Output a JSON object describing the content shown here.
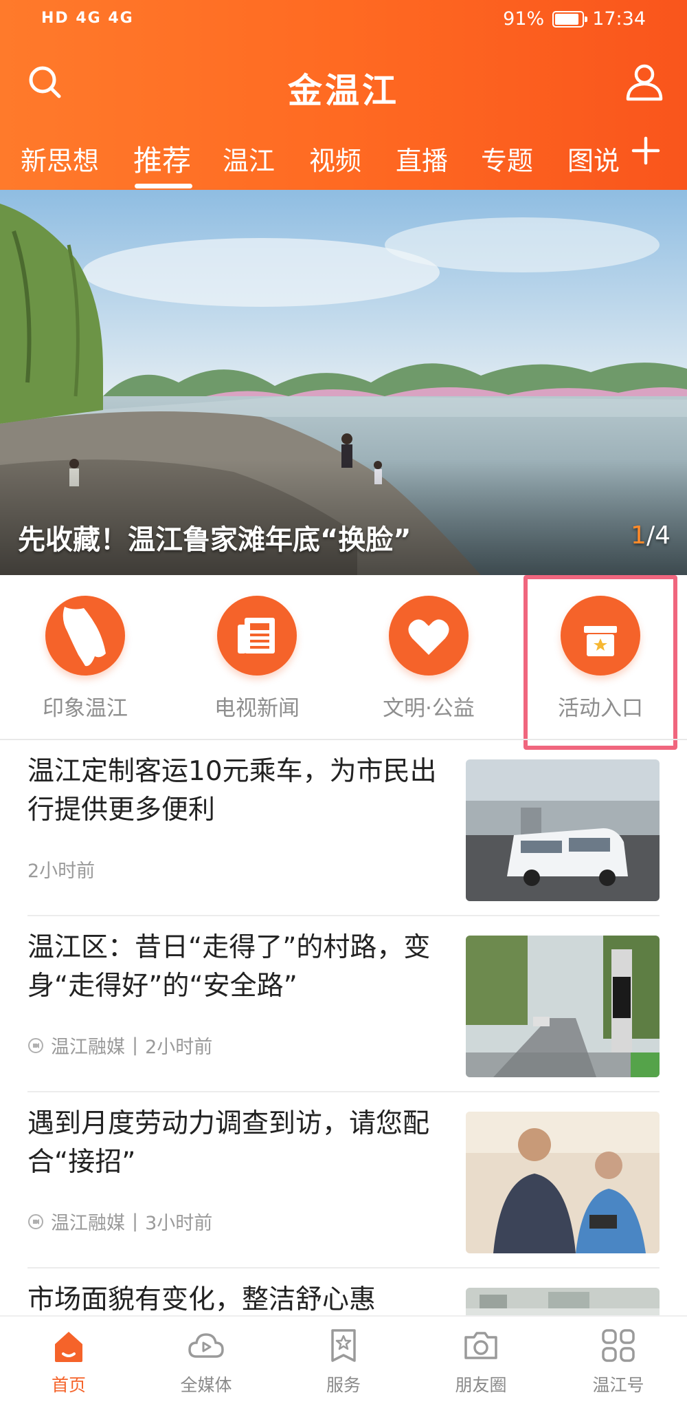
{
  "status_bar": {
    "left": "HD 4G 4G",
    "battery": "91%",
    "time": "17:34"
  },
  "app": {
    "title": "金温江"
  },
  "tabs": [
    "新思想",
    "推荐",
    "温江",
    "视频",
    "直播",
    "专题",
    "图说"
  ],
  "active_tab": "推荐",
  "banner": {
    "caption": "先收藏！温江鲁家滩年底“换脸”",
    "current": "1",
    "total": "/4"
  },
  "shortcuts": [
    {
      "label": "印象温江",
      "icon": "map-icon"
    },
    {
      "label": "电视新闻",
      "icon": "newspaper-icon"
    },
    {
      "label": "文明·公益",
      "icon": "heart-icon"
    },
    {
      "label": "活动入口",
      "icon": "gift-icon"
    }
  ],
  "news": [
    {
      "title": "温江定制客运10元乘车，为市民出行提供更多便利",
      "meta": "2小时前",
      "source": "",
      "thumb": "van"
    },
    {
      "title": "温江区：昔日“走得了”的村路，变身“走得好”的“安全路”",
      "meta": "2小时前",
      "source": "温江融媒",
      "thumb": "road"
    },
    {
      "title": "遇到月度劳动力调查到访，请您配合“接招”",
      "meta": "3小时前",
      "source": "温江融媒",
      "thumb": "people"
    },
    {
      "title": "市场面貌有变化，整洁舒心惠",
      "meta": "",
      "source": "",
      "thumb": "market"
    }
  ],
  "bottom_nav": [
    {
      "label": "首页",
      "icon": "home-icon",
      "active": true
    },
    {
      "label": "全媒体",
      "icon": "media-cloud-icon",
      "active": false
    },
    {
      "label": "服务",
      "icon": "service-star-icon",
      "active": false
    },
    {
      "label": "朋友圈",
      "icon": "camera-icon",
      "active": false
    },
    {
      "label": "温江号",
      "icon": "grid-icon",
      "active": false
    }
  ],
  "colors": {
    "brand": "#f5632a",
    "header_start": "#ff7a2b",
    "header_end": "#f9551c",
    "highlight": "#f0667e"
  }
}
